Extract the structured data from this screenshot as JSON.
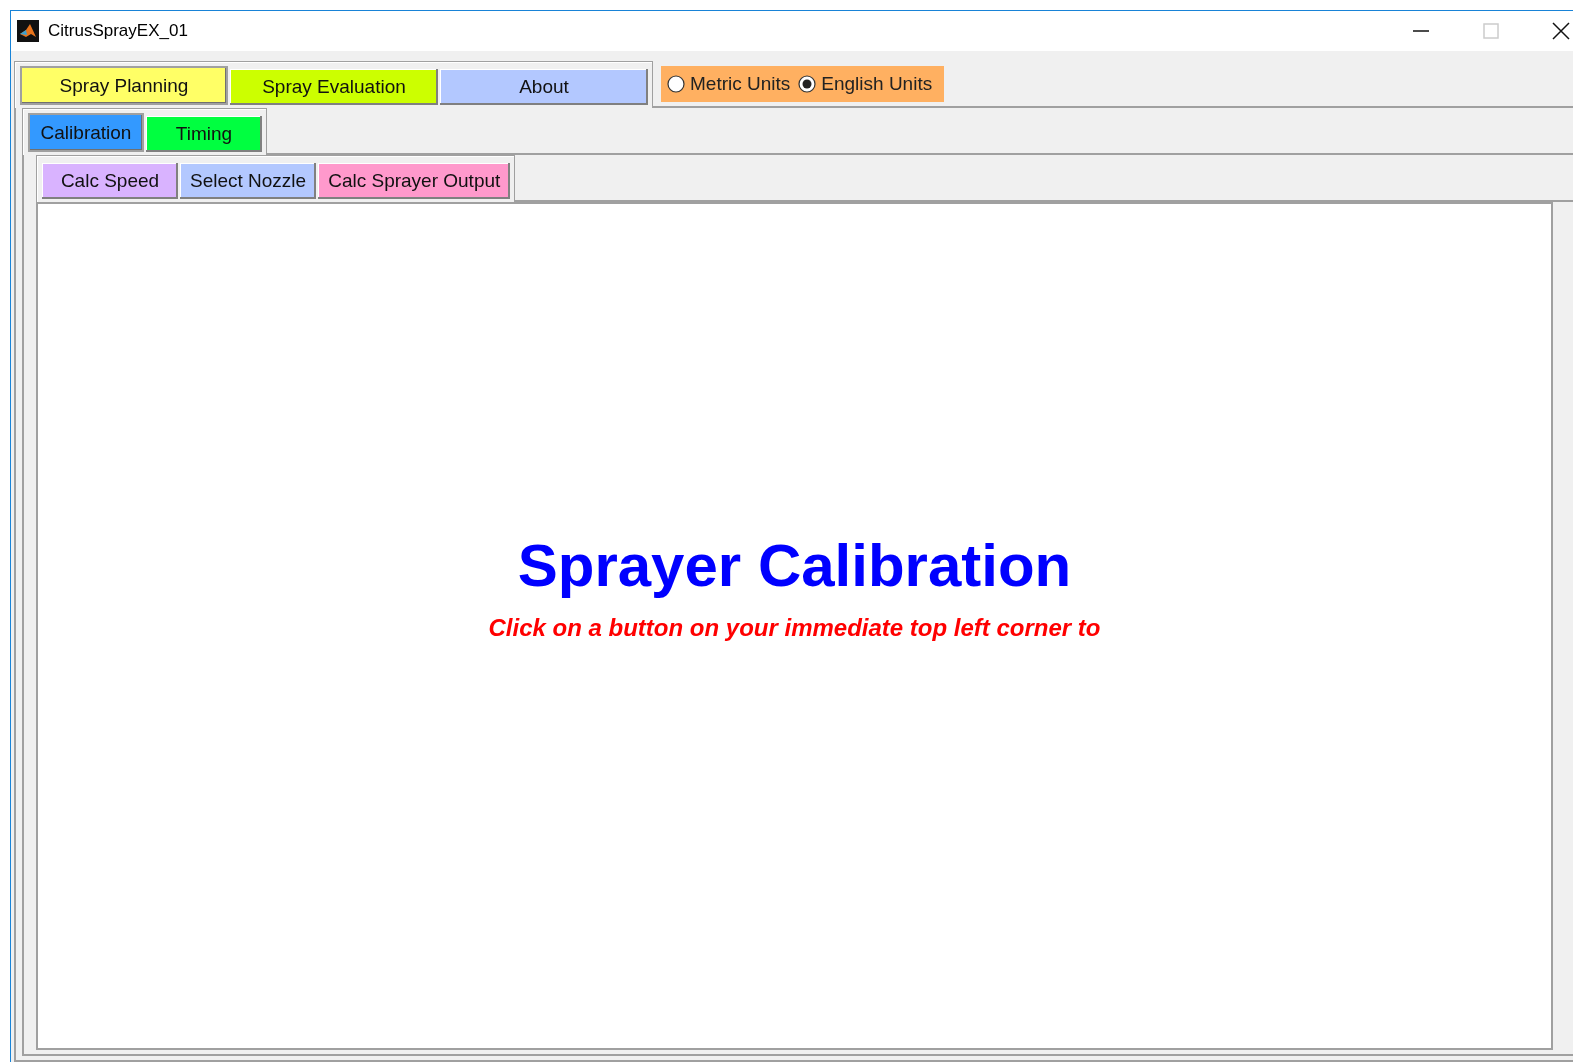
{
  "window": {
    "title": "CitrusSprayEX_01"
  },
  "main_tabs": [
    {
      "label": "Spray Planning",
      "color": "#ffff66",
      "selected": true
    },
    {
      "label": "Spray Evaluation",
      "color": "#ccff00",
      "selected": false
    },
    {
      "label": "About",
      "color": "#b3c8ff",
      "selected": false
    }
  ],
  "units": {
    "color": "#ffb061",
    "options": [
      {
        "label": "Metric Units",
        "selected": false
      },
      {
        "label": "English Units",
        "selected": true
      }
    ]
  },
  "sub_tabs": [
    {
      "label": "Calibration",
      "color": "#3399ff",
      "selected": true
    },
    {
      "label": "Timing",
      "color": "#00ff40",
      "selected": false
    }
  ],
  "tool_tabs": [
    {
      "label": "Calc Speed",
      "color": "#d9b3ff",
      "selected": false
    },
    {
      "label": "Select Nozzle",
      "color": "#b3c8ff",
      "selected": false
    },
    {
      "label": "Calc Sprayer Output",
      "color": "#ff99cc",
      "selected": false
    }
  ],
  "panel": {
    "title": "Sprayer Calibration",
    "instruction": "Click on a button on your immediate top left corner to"
  }
}
